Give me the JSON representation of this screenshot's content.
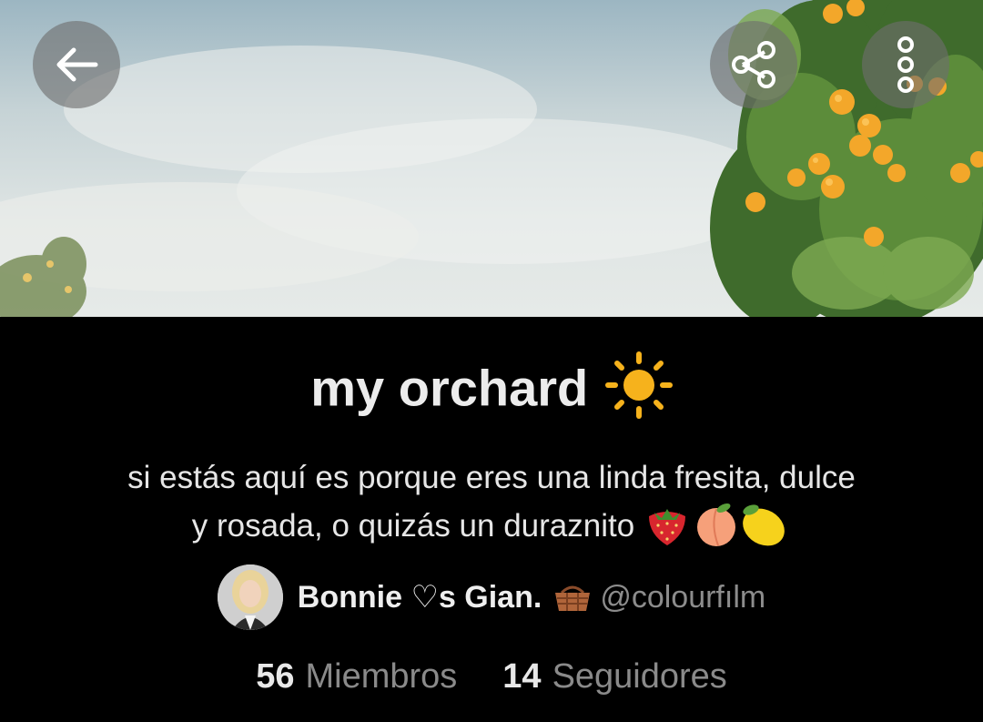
{
  "header": {
    "back_icon": "arrow-left-icon",
    "share_icon": "share-icon",
    "more_icon": "more-vertical-icon",
    "banner": "sky with orange tree"
  },
  "community": {
    "title": "my orchard",
    "title_emoji": "sun",
    "description_line1": "si estás aquí es porque eres una linda fresita, dulce",
    "description_line2": "y rosada, o quizás un duraznito",
    "description_emojis": [
      "strawberry",
      "peach",
      "lemon"
    ]
  },
  "author": {
    "name": "Bonnie ♡s Gian.",
    "name_emoji": "basket",
    "handle": "@colourfılm"
  },
  "stats": {
    "members_count": "56",
    "members_label": "Miembros",
    "followers_count": "14",
    "followers_label": "Seguidores"
  },
  "colors": {
    "background": "#000000",
    "title": "#ececec",
    "muted": "#8a8a8a",
    "sun": "#f6b21c"
  }
}
